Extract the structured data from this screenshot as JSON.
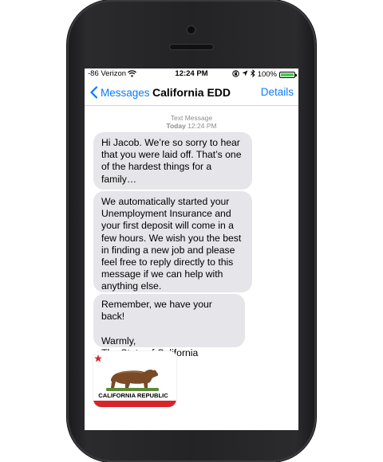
{
  "status_bar": {
    "carrier": "-86 Verizon",
    "time": "12:24 PM",
    "battery_percent": "100%",
    "battery_level": 1.0,
    "icons": [
      "wifi-icon",
      "screen-lock-icon",
      "location-icon",
      "bluetooth-icon",
      "battery-icon"
    ]
  },
  "nav": {
    "back_label": "Messages",
    "title": "California EDD",
    "details_label": "Details"
  },
  "conversation": {
    "meta_type": "Text Message",
    "meta_day": "Today",
    "meta_time": "12:24 PM",
    "messages": [
      "Hi Jacob. We’re so sorry to hear that you were laid off. That’s one of the hardest things for a family…",
      "We automatically started your Unemployment Insurance and your first deposit will come in a few hours. We wish you the best in finding a new job and please feel free to reply directly to this message if we can help with anything else.",
      "Remember, we have your back!\n\nWarmly,\nThe State of California"
    ],
    "image_caption": "CALIFORNIA REPUBLIC",
    "flag_colors": {
      "star": "#d7252b",
      "stripe": "#d7252b",
      "bear": "#7b4a26"
    }
  }
}
